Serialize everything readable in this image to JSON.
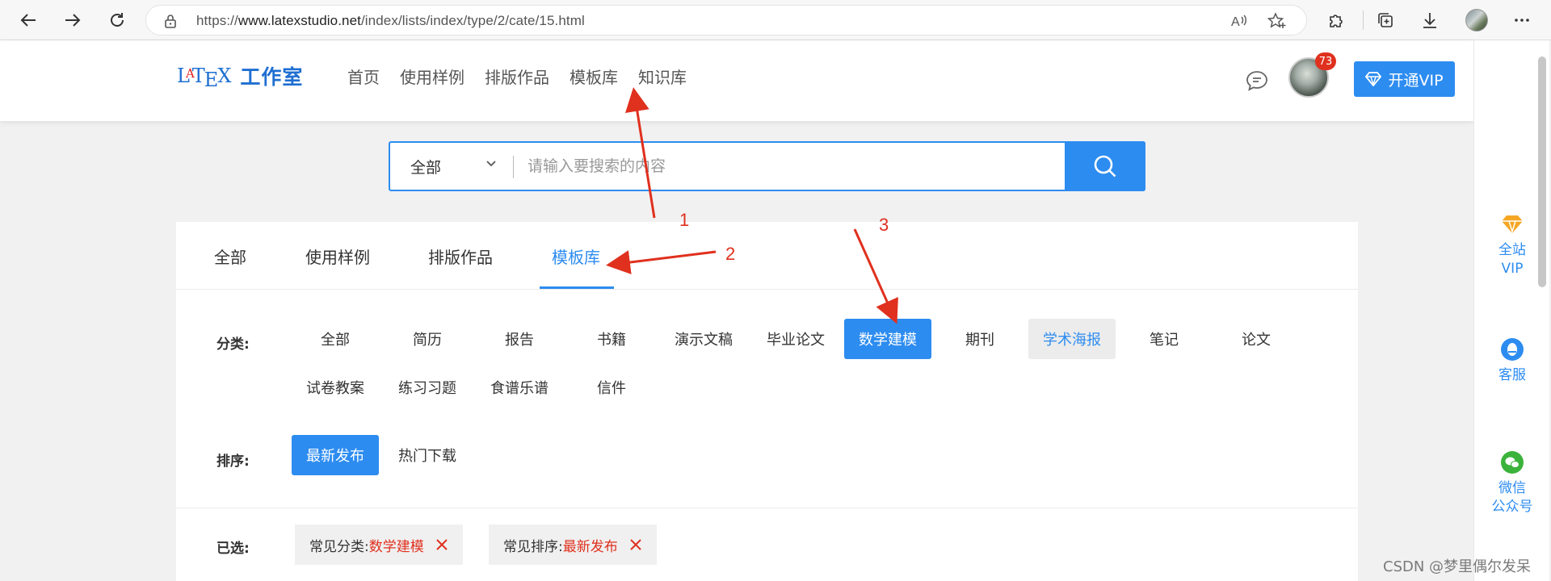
{
  "browser": {
    "url_prefix": "https://",
    "url_host": "www.latexstudio.net",
    "url_path": "/index/lists/index/type/2/cate/15.html"
  },
  "site": {
    "logo_text": "L A T E X",
    "logo_l": "L",
    "logo_a": "A",
    "logo_t": "T",
    "logo_e": "E",
    "logo_x": "X",
    "logo_name": "工作室",
    "nav": [
      "首页",
      "使用样例",
      "排版作品",
      "模板库",
      "知识库"
    ],
    "notification_count": "73",
    "vip_label": "开通VIP"
  },
  "search": {
    "category": "全部",
    "placeholder": "请输入要搜索的内容"
  },
  "tabs": [
    "全部",
    "使用样例",
    "排版作品",
    "模板库"
  ],
  "active_tab": "模板库",
  "filters": {
    "category_label": "分类:",
    "categories": [
      "全部",
      "简历",
      "报告",
      "书籍",
      "演示文稿",
      "毕业论文",
      "数学建模",
      "期刊",
      "学术海报",
      "笔记",
      "论文",
      "试卷教案",
      "练习习题",
      "食谱乐谱",
      "信件"
    ],
    "selected_category": "数学建模",
    "hover_category": "学术海报",
    "sort_label": "排序:",
    "sorts": [
      "最新发布",
      "热门下载"
    ],
    "selected_sort": "最新发布",
    "chosen_label": "已选:",
    "chosen": [
      {
        "key": "常见分类:",
        "value": "数学建模"
      },
      {
        "key": "常见排序:",
        "value": "最新发布"
      }
    ]
  },
  "sidebar": {
    "vip": {
      "line1": "全站",
      "line2": "VIP"
    },
    "service": {
      "line1": "客服"
    },
    "wechat": {
      "line1": "微信",
      "line2": "公众号"
    }
  },
  "annotations": [
    "1",
    "2",
    "3"
  ],
  "watermark": "CSDN @梦里偶尔发呆",
  "colors": {
    "accent": "#2d8cf0",
    "annotation": "#e0301e",
    "chip_value": "#e0301e",
    "vip_icon": "#f5a623",
    "wechat": "#3bb33b"
  }
}
